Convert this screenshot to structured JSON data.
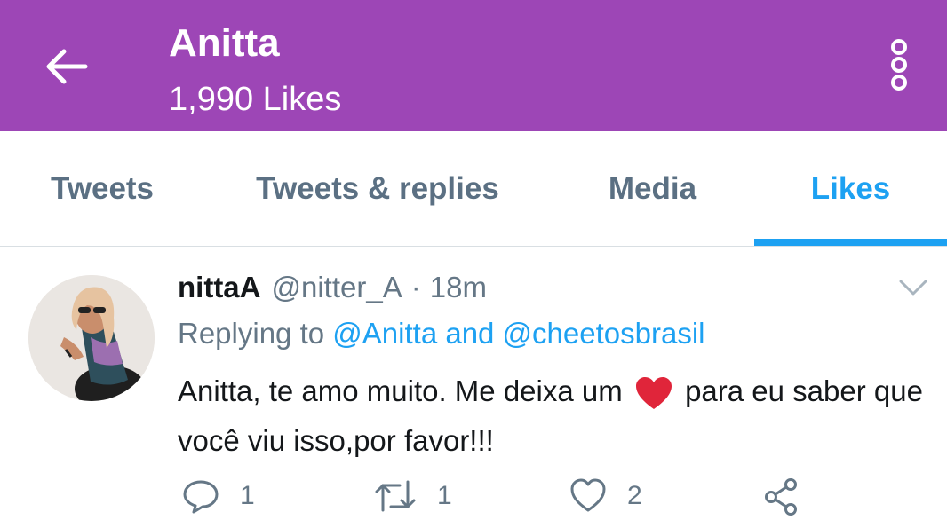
{
  "header": {
    "title": "Anitta",
    "subtitle": "1,990 Likes",
    "background_color": "#9d46b6",
    "back_icon": "arrow-left-icon",
    "more_icon": "more-vertical-icon"
  },
  "tabs": [
    {
      "label": "Tweets",
      "active": false
    },
    {
      "label": "Tweets & replies",
      "active": false
    },
    {
      "label": "Media",
      "active": false
    },
    {
      "label": "Likes",
      "active": true
    }
  ],
  "accent_color": "#1da1f2",
  "tweet": {
    "display_name": "nittaA",
    "handle": "@nitter_A",
    "separator": "·",
    "time": "18m",
    "replying_prefix": "Replying to",
    "replying_mentions": "@Anitta and @cheetosbrasil",
    "text_before_emoji": "Anitta, te amo muito. Me deixa um",
    "emoji": "red-heart-emoji",
    "text_after_emoji": "para eu saber que você viu isso,por favor!!!",
    "actions": {
      "reply": {
        "icon": "reply-icon",
        "count": "1"
      },
      "retweet": {
        "icon": "retweet-icon",
        "count": "1"
      },
      "like": {
        "icon": "heart-icon",
        "count": "2"
      },
      "share": {
        "icon": "share-icon"
      }
    }
  }
}
